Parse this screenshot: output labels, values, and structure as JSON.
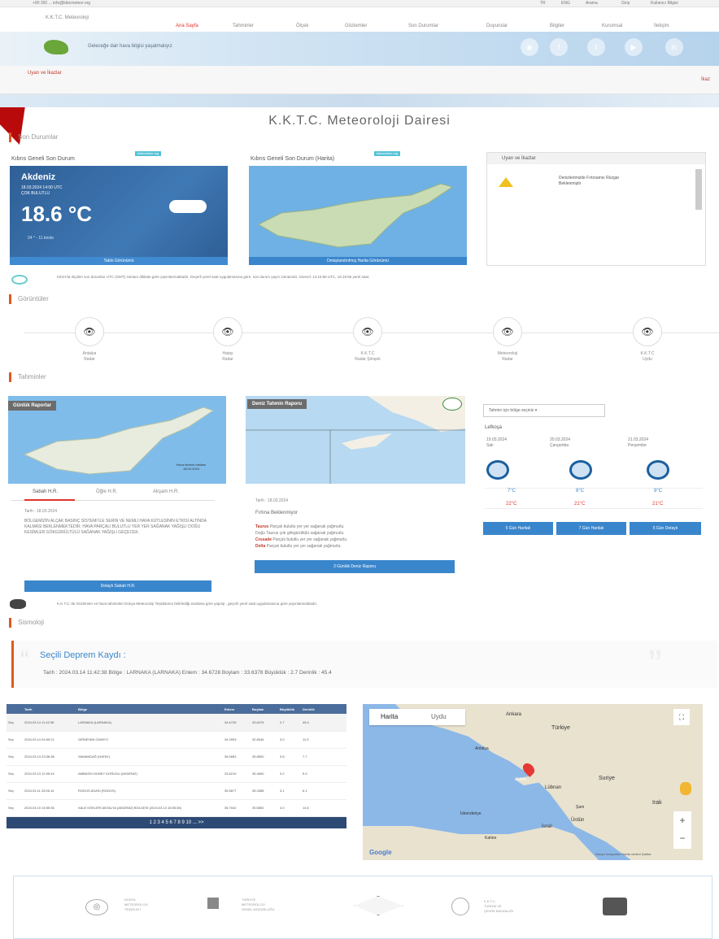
{
  "topbar": {
    "left": "+90 392 ... info@kktcmeteor.org",
    "right": [
      "TR",
      "ENG",
      "Arama",
      "Giriş",
      "Kullanıcı Bilgisi"
    ]
  },
  "brand": {
    "name": "K.K.T.C. Meteoroloji",
    "slogan": "Geleceğe dair hava bilgisi yaşatmalıyız"
  },
  "nav": [
    "Ana Sayfa",
    "Tahminler",
    "Ölçek",
    "Gözlemler",
    "Son Durumlar",
    "Duyurular",
    "Bilgiler",
    "Kurumsal",
    "İletişim"
  ],
  "nav_active": "Ana Sayfa",
  "warnings": {
    "title": "Uyarı ve İkazlar",
    "label": "İkaz"
  },
  "page_title": "K.K.T.C. Meteoroloji Dairesi",
  "sections": {
    "current": "Son Durumlar",
    "radar": "Görüntüler",
    "forecast": "Tahminler",
    "seismic": "Sismoloji"
  },
  "current": {
    "card1_title": "Kıbrıs Geneli Son Durum",
    "card1_tag": "kktcmeteor.org",
    "region": "Akdeniz",
    "datetime": "18.03.2024 14:00 UTC",
    "condition": "ÇOK BULUTLU",
    "temp": "18.6 °C",
    "wind": "24 ° - 11 knots",
    "card1_btn": "Tablo Görünümü",
    "card2_title": "Kıbrıs Geneli Son Durum (Harita)",
    "card2_tag": "kktcmeteor.org",
    "card2_btn": "Detaylandırılmış Harita Görünümü",
    "card3_title": "Uyarı ve İkazlar",
    "card3_text": "Denizlerimizde Fırtınamsı Rüzgar Beklenmiştir"
  },
  "info_line": "Kıbrıs'ta ölçülen son durumlar UTC (GMT) zamanı dikkate göre yayınlanmaktadır. Geçerli yerel saat uygulamasına göre, son durum yayın zamanıdır. Güncel: 14:15:56 UTC, 16:15:56 yerel saat.",
  "radars": [
    {
      "icon": "eye-icon",
      "l1": "Antalya",
      "l2": "Radar"
    },
    {
      "icon": "eye-icon",
      "l1": "Hatay",
      "l2": "Radar"
    },
    {
      "icon": "eye-icon",
      "l1": "K.K.T.C",
      "l2": "Radar Şimşek"
    },
    {
      "icon": "eye-icon",
      "l1": "Meteoroloji",
      "l2": "Radar"
    },
    {
      "icon": "eye-icon",
      "l1": "K.K.T.C",
      "l2": "Uydu"
    }
  ],
  "forecast": {
    "map1_tag": "Günlük Raporlar",
    "map1_note": "Hava tahmin haritası 18.03.2024",
    "tabs": [
      "Sabah H.R.",
      "Öğle H.R.",
      "Akşam H.R."
    ],
    "date": "Tarih : 18.03.2024",
    "text": "BÖLGEMİZİN ALÇAK BASINÇ SİSTEMİ İLE SERİN VE NEMLİ HAVA KÜTLESİNİN ETKİSİ ALTINDA KALMASI BEKLENMEKTEDİR. HAVA PARÇALI BULUTLU YER YER SAĞANAK YAĞIŞLI DOĞU KESİMLER GÖKGÜRÜLTÜLÜ SAĞANAK YAĞIŞLI GEÇECEK.",
    "btn1": "Detaylı Sabah H.R.",
    "map2_tag": "Deniz Tahmin Raporu",
    "date2": "Tarih : 18.03.2024",
    "storm": "Fırtına Beklenmiyor",
    "sea_lines": [
      {
        "name": "Taurus",
        "text": "Parçalı bulutlu yer yer sağanak yağmurlu."
      },
      {
        "name": "",
        "text": "Doğu Taurus çok gökgürültülü sağanak yağmurlu."
      },
      {
        "name": "Crusade",
        "text": "Parçalı bulutlu yer yer sağanak yağmurlu."
      },
      {
        "name": "Delta",
        "text": "Parçalı bulutlu yer yer sağanak yağmurlu."
      }
    ],
    "btn2": "3 Günlük Deniz Raporu",
    "select": "Tahmin için bölge seçiniz",
    "city": "Lefkoşa",
    "days": [
      {
        "date": "19.03.2024",
        "day": "Salı",
        "min": "7°C",
        "max": "22°C"
      },
      {
        "date": "20.03.2024",
        "day": "Çarşamba",
        "min": "8°C",
        "max": "21°C"
      },
      {
        "date": "21.03.2024",
        "day": "Perşembe",
        "min": "9°C",
        "max": "21°C"
      }
    ],
    "btns": [
      "5 Gün Haritalı",
      "7 Gün Haritalı",
      "5 Gün Detaylı"
    ]
  },
  "wmo_line": "K.K.T.C.'de Gözlemler ve hava tahminleri Dünya Meteoroloji Teşkilatının belirlediği esaslara göre yapılıp , geçerli yerel saat uygulamasına göre yayınlanmaktadır.",
  "seismic": {
    "title": "Seçili Deprem Kaydı :",
    "detail": "Tarih : 2024.03.14 11:42:38   Bölge : LARNAKA (LARNAKA)   Enlem : 34.6728   Boylam : 33.6378   Büyüklük : 2.7   Derinlik : 45.4",
    "headers": [
      "",
      "Tarih",
      "Bölge",
      "Enlem",
      "Boylam",
      "Büyüklük",
      "Derinlik"
    ],
    "rows": [
      [
        "Seç",
        "2024.03.14 11:42:38",
        "LARNAKA (LARNAKA)",
        "34.6728",
        "33.6378",
        "2.7",
        "45.4"
      ],
      [
        "Seç",
        "2024.03.14 04:59:21",
        "GİRNE'NİN GÜNEYİ",
        "34.2993",
        "32.8046",
        "3.0",
        "11.5"
      ],
      [
        "Seç",
        "2024.03.13 23:36:38",
        "SAMANDAĞ (HATAY)",
        "36.0683",
        "35.8500",
        "3.8",
        "7.7"
      ],
      [
        "Seç",
        "2024.03.13 12:05:44",
        "AMBASSI GÜNEY DOĞUSU (AKDENİZ)",
        "33.6210",
        "35.4690",
        "3.2",
        "5.9"
      ],
      [
        "Seç",
        "2024.03.11 23:06:14",
        "RODOS ADASI (RODOS)",
        "35.5877",
        "35.3388",
        "3.1",
        "6.1"
      ],
      [
        "Seç",
        "2024.03.10 15:55:36",
        "KALE KÖKLERİ ANTALYA (AKDENİZ) BÖLGESİ (2024.03.10 15:55:36)",
        "36.7042",
        "30.5892",
        "4.0",
        "14.6"
      ]
    ],
    "pager": "1 2 3 4 5 6 7 8 9 10 ... >>"
  },
  "map": {
    "tab1": "Harita",
    "tab2": "Uydu",
    "labels": [
      "Ankara",
      "Türkiye",
      "Antalya",
      "Suriye",
      "Lübnan",
      "Irak",
      "İsrail",
      "Ürdün",
      "Kıbrıs",
      "İskenderiye",
      "Kahire",
      "Şam"
    ],
    "google": "Google",
    "footer": "Klavye kısayolları   Harita verileri   Şartlar"
  },
  "footer": [
    {
      "icon": "globe-icon",
      "l1": "DÜNYA",
      "l2": "METEOROLOJİ",
      "l3": "TEŞKİLATI"
    },
    {
      "icon": "flag-icon",
      "l1": "TÜRKİYE",
      "l2": "METEOROLOJİ",
      "l3": "GENEL MÜDÜRLÜĞÜ"
    },
    {
      "icon": "diamond-icon",
      "l1": "",
      "l2": "",
      "l3": ""
    },
    {
      "icon": "seal-icon",
      "l1": "K.K.T.C.",
      "l2": "TURİZM VE",
      "l3": "ÇEVRE BAKANLIĞI"
    },
    {
      "icon": "phone-icon",
      "l1": "",
      "l2": "",
      "l3": ""
    }
  ]
}
